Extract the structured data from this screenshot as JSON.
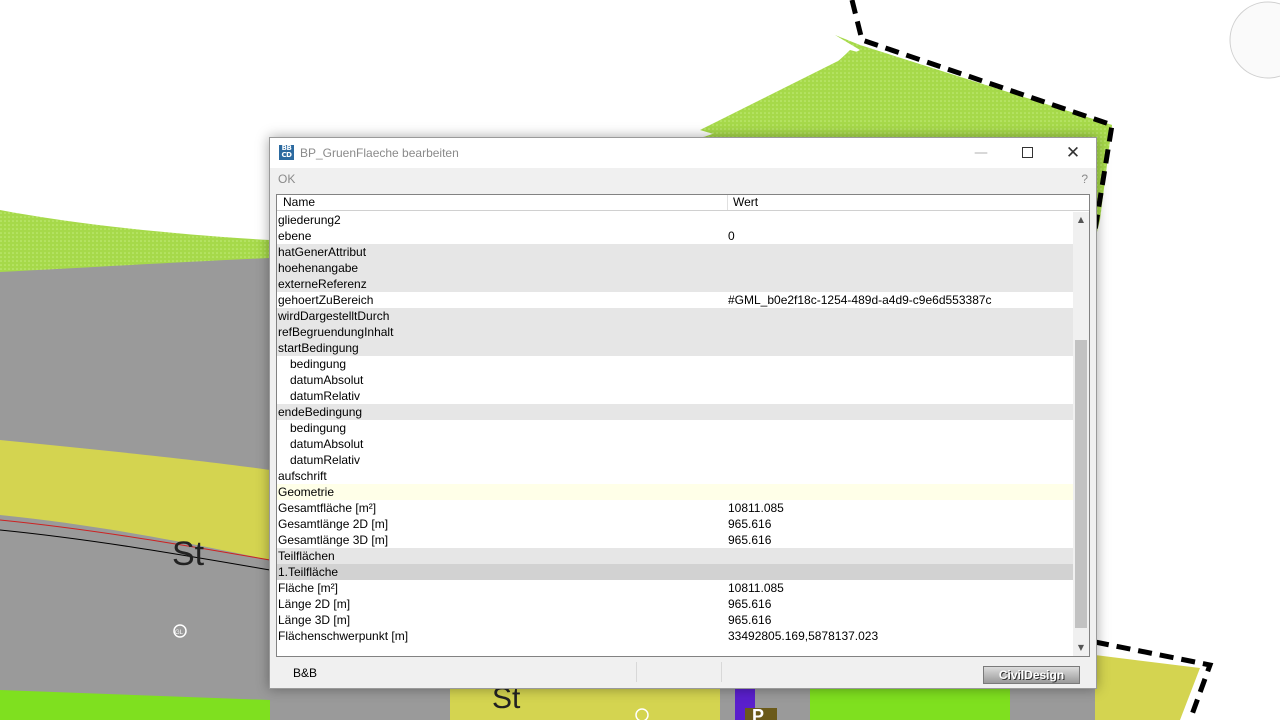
{
  "map": {
    "labels": [
      {
        "text": "St"
      },
      {
        "text": "St"
      }
    ],
    "markers": [
      "GL",
      "GL"
    ],
    "box_label": "P"
  },
  "dialog": {
    "title": "BP_GruenFlaeche bearbeiten",
    "window_buttons": {
      "minimize": "—",
      "maximize": "□",
      "close": "✕"
    },
    "menu": {
      "ok": "OK",
      "help": "?"
    },
    "columns": {
      "name": "Name",
      "value": "Wert"
    },
    "rows": [
      {
        "name": "gliederung2",
        "value": "",
        "style": "white",
        "indent": false
      },
      {
        "name": "ebene",
        "value": "0",
        "style": "white",
        "indent": false
      },
      {
        "name": "hatGenerAttribut",
        "value": "",
        "style": "grey",
        "indent": false
      },
      {
        "name": "hoehenangabe",
        "value": "",
        "style": "grey",
        "indent": false
      },
      {
        "name": "externeReferenz",
        "value": "",
        "style": "grey",
        "indent": false
      },
      {
        "name": "gehoertZuBereich",
        "value": "#GML_b0e2f18c-1254-489d-a4d9-c9e6d553387c",
        "style": "white",
        "indent": false
      },
      {
        "name": "wirdDargestelltDurch",
        "value": "",
        "style": "grey",
        "indent": false
      },
      {
        "name": "refBegruendungInhalt",
        "value": "",
        "style": "grey",
        "indent": false
      },
      {
        "name": "startBedingung",
        "value": "",
        "style": "grey",
        "indent": false
      },
      {
        "name": "bedingung",
        "value": "",
        "style": "white",
        "indent": true
      },
      {
        "name": "datumAbsolut",
        "value": "",
        "style": "white",
        "indent": true
      },
      {
        "name": "datumRelativ",
        "value": "",
        "style": "white",
        "indent": true
      },
      {
        "name": "endeBedingung",
        "value": "",
        "style": "grey",
        "indent": false
      },
      {
        "name": "bedingung",
        "value": "",
        "style": "white",
        "indent": true
      },
      {
        "name": "datumAbsolut",
        "value": "",
        "style": "white",
        "indent": true
      },
      {
        "name": "datumRelativ",
        "value": "",
        "style": "white",
        "indent": true
      },
      {
        "name": "aufschrift",
        "value": "",
        "style": "white",
        "indent": false
      },
      {
        "name": "Geometrie",
        "value": "",
        "style": "yellow",
        "indent": false
      },
      {
        "name": "Gesamtfläche [m²]",
        "value": "10811.085",
        "style": "white",
        "indent": false
      },
      {
        "name": "Gesamtlänge 2D [m]",
        "value": "965.616",
        "style": "white",
        "indent": false
      },
      {
        "name": "Gesamtlänge 3D [m]",
        "value": "965.616",
        "style": "white",
        "indent": false
      },
      {
        "name": "Teilflächen",
        "value": "",
        "style": "grey",
        "indent": false
      },
      {
        "name": "1.Teilfläche",
        "value": "",
        "style": "dark",
        "indent": false
      },
      {
        "name": "Fläche [m²]",
        "value": "10811.085",
        "style": "white",
        "indent": false
      },
      {
        "name": "Länge 2D [m]",
        "value": "965.616",
        "style": "white",
        "indent": false
      },
      {
        "name": "Länge 3D [m]",
        "value": "965.616",
        "style": "white",
        "indent": false
      },
      {
        "name": "Flächenschwerpunkt [m]",
        "value": "33492805.169,5878137.023",
        "style": "white",
        "indent": false
      }
    ],
    "scroll": {
      "up": "▲",
      "down": "▼"
    },
    "status": {
      "text": "B&B",
      "logo": "CivilDesign"
    }
  }
}
